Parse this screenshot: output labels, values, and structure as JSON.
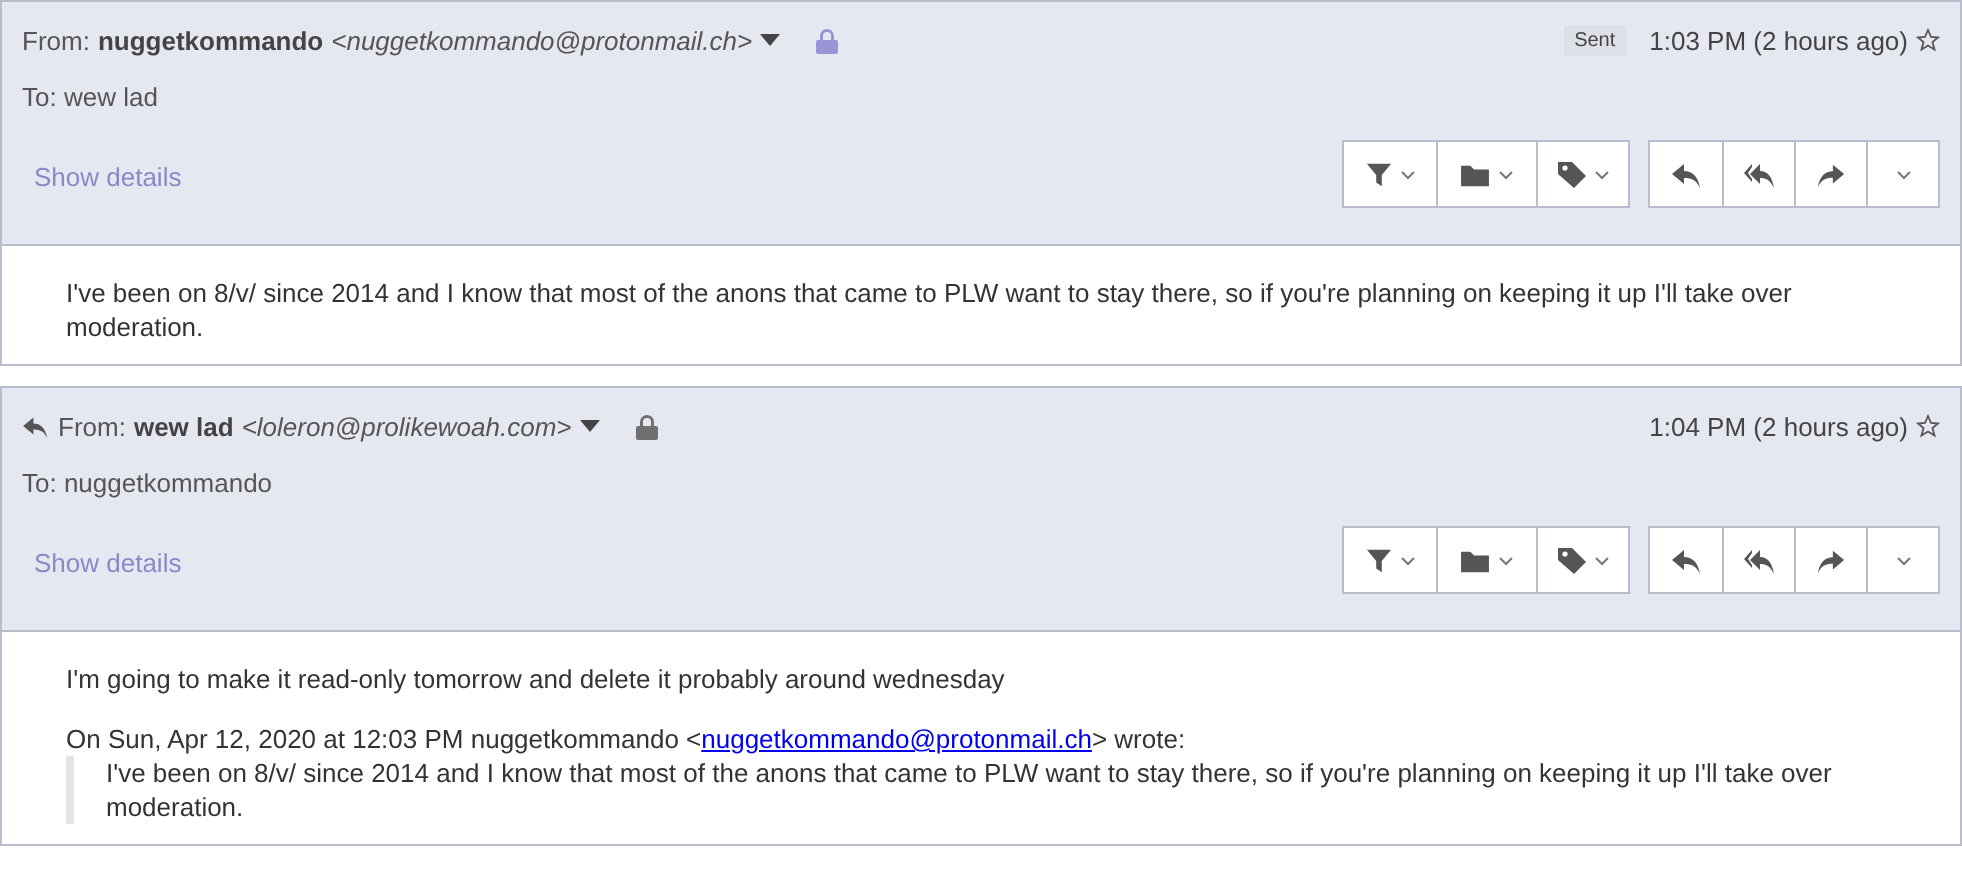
{
  "messages": [
    {
      "replied": false,
      "from_label": "From:",
      "sender_name": "nuggetkommando",
      "sender_address": "<nuggetkommando@protonmail.ch>",
      "lock": {
        "color": "#9b94d4"
      },
      "badge": "Sent",
      "time": "1:03 PM (2 hours ago)",
      "starred": false,
      "to_label": "To: wew lad",
      "details_link": "Show details",
      "body": [
        {
          "kind": "text",
          "text": "I've been on 8/v/ since 2014 and I know that most of the anons that came to PLW want to stay there, so if you're planning on keeping it up I'll take over moderation."
        }
      ]
    },
    {
      "replied": true,
      "from_label": "From:",
      "sender_name": "wew lad",
      "sender_address": "<loleron@prolikewoah.com>",
      "lock": {
        "color": "#707070"
      },
      "time": "1:04 PM (2 hours ago)",
      "starred": false,
      "to_label": "To: nuggetkommando",
      "details_link": "Show details",
      "body": [
        {
          "kind": "text",
          "text": "I'm going to make it read-only tomorrow and delete it probably around wednesday"
        },
        {
          "kind": "attribution",
          "before": "On Sun, Apr 12, 2020 at 12:03 PM nuggetkommando <",
          "link": "nuggetkommando@protonmail.ch",
          "after": "> wrote:"
        },
        {
          "kind": "quote",
          "text": "I've been on 8/v/ since 2014 and I know that most of the anons that came to PLW want to stay there, so if you're planning on keeping it up I'll take over moderation."
        }
      ]
    }
  ]
}
